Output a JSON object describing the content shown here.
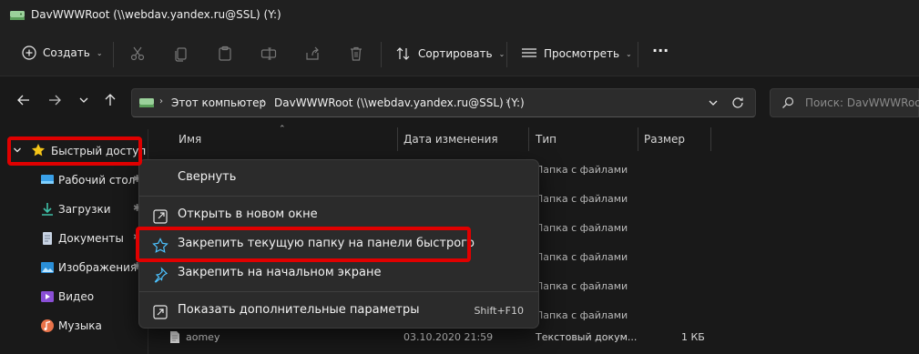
{
  "window": {
    "title": "DavWWWRoot (\\\\webdav.yandex.ru@SSL) (Y:)"
  },
  "toolbar": {
    "create_label": "Создать",
    "sort_label": "Сортировать",
    "view_label": "Просмотреть",
    "more_label": "···"
  },
  "address": {
    "crumb_computer": "Этот компьютер",
    "crumb_drive": "DavWWWRoot (\\\\webdav.yandex.ru@SSL) (Y:)",
    "sep": "›"
  },
  "search": {
    "placeholder": "Поиск: DavWWWRoot (\\\\we"
  },
  "sidebar": {
    "quick_access": "Быстрый доступ",
    "items": [
      {
        "label": "Рабочий стол",
        "icon": "desktop-icon"
      },
      {
        "label": "Загрузки",
        "icon": "download-icon"
      },
      {
        "label": "Документы",
        "icon": "documents-icon"
      },
      {
        "label": "Изображения",
        "icon": "pictures-icon"
      },
      {
        "label": "Видео",
        "icon": "video-icon"
      },
      {
        "label": "Музыка",
        "icon": "music-icon"
      }
    ],
    "pin_glyph": "✱"
  },
  "columns": {
    "name": "Имя",
    "modified": "Дата изменения",
    "type": "Тип",
    "size": "Размер"
  },
  "rows": [
    {
      "type": "Папка с файлами"
    },
    {
      "type": "Папка с файлами"
    },
    {
      "type": "Папка с файлами"
    },
    {
      "type": "Папка с файлами"
    },
    {
      "type": "Папка с файлами"
    },
    {
      "type": "Папка с файлами"
    }
  ],
  "file_row": {
    "name": "aomey",
    "modified": "03.10.2020 21:59",
    "type": "Текстовый докум...",
    "size": "1 КБ"
  },
  "context_menu": {
    "collapse": "Свернуть",
    "open_new_window": "Открыть в новом окне",
    "pin_quick_access": "Закрепить текущую папку на панели быстрого",
    "pin_start": "Закрепить на начальном экране",
    "more_options": "Показать дополнительные параметры",
    "more_options_shortcut": "Shift+F10"
  },
  "colors": {
    "highlight": "#e00000",
    "accent": "#4cc2ff",
    "folder": "#f2c14e"
  }
}
